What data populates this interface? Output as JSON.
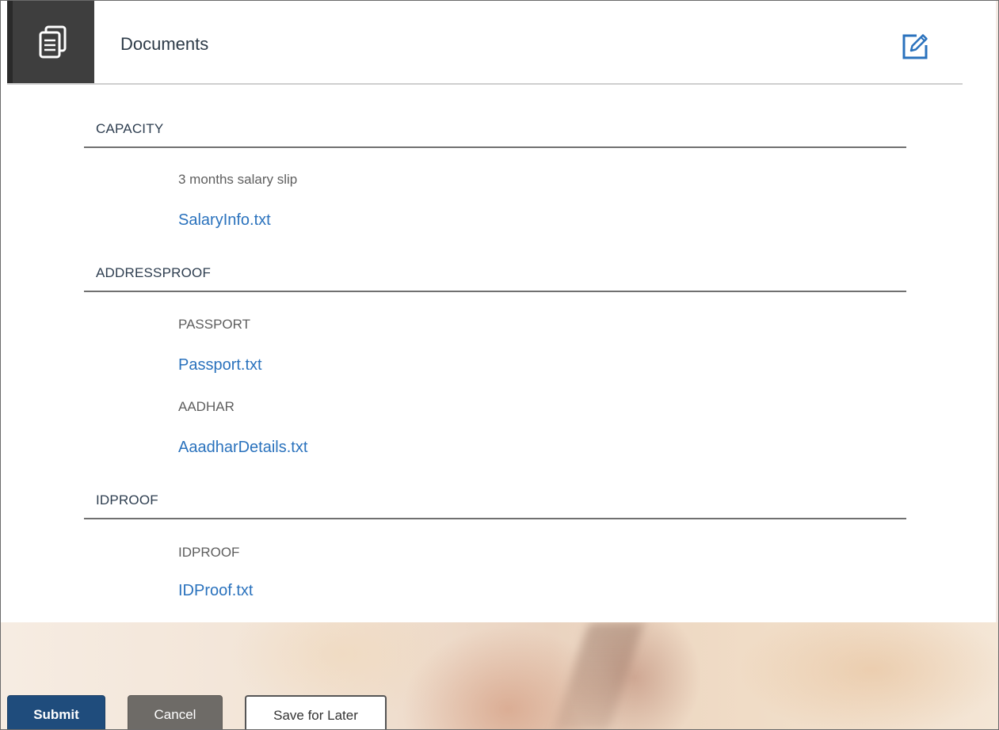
{
  "header": {
    "title": "Documents",
    "icon": "documents-icon",
    "edit_icon": "edit-icon"
  },
  "sections": [
    {
      "title": "CAPACITY",
      "documents": [
        {
          "type": "3 months salary slip",
          "file": "SalaryInfo.txt"
        }
      ]
    },
    {
      "title": "ADDRESSPROOF",
      "documents": [
        {
          "type": "PASSPORT",
          "file": "Passport.txt"
        },
        {
          "type": "AADHAR",
          "file": "AaadharDetails.txt"
        }
      ]
    },
    {
      "title": "IDPROOF",
      "documents": [
        {
          "type": "IDPROOF",
          "file": "IDProof.txt"
        }
      ]
    }
  ],
  "actions": {
    "submit_label": "Submit",
    "cancel_label": "Cancel",
    "save_later_label": "Save for Later"
  },
  "colors": {
    "link": "#2a72bd",
    "submit": "#1f4c7c",
    "cancel": "#6e6b67",
    "header_icon_bg": "#3e3e3e"
  }
}
